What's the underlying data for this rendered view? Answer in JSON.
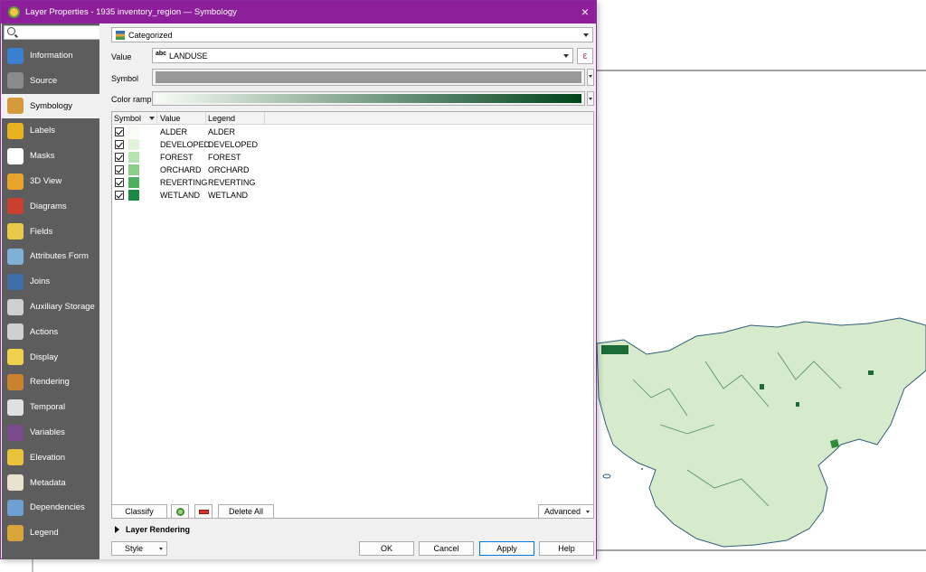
{
  "window": {
    "title": "Layer Properties - 1935 inventory_region — Symbology",
    "close": "×"
  },
  "sidebar": {
    "search_placeholder": "",
    "items": [
      {
        "label": "Information",
        "icon": "information-icon",
        "color": "#3b7fd1"
      },
      {
        "label": "Source",
        "icon": "source-icon",
        "color": "#8a8a8a"
      },
      {
        "label": "Symbology",
        "icon": "symbology-icon",
        "color": "#d49a3c"
      },
      {
        "label": "Labels",
        "icon": "labels-icon",
        "color": "#e6b31e"
      },
      {
        "label": "Masks",
        "icon": "masks-icon",
        "color": "#ffffff"
      },
      {
        "label": "3D View",
        "icon": "3d-view-icon",
        "color": "#e8a32a"
      },
      {
        "label": "Diagrams",
        "icon": "diagrams-icon",
        "color": "#c9402e"
      },
      {
        "label": "Fields",
        "icon": "fields-icon",
        "color": "#e9c94a"
      },
      {
        "label": "Attributes Form",
        "icon": "attributes-form-icon",
        "color": "#7fb0d8"
      },
      {
        "label": "Joins",
        "icon": "joins-icon",
        "color": "#3d6ea8"
      },
      {
        "label": "Auxiliary Storage",
        "icon": "auxiliary-storage-icon",
        "color": "#cfcfcf"
      },
      {
        "label": "Actions",
        "icon": "actions-icon",
        "color": "#d0d0d0"
      },
      {
        "label": "Display",
        "icon": "display-icon",
        "color": "#f0d14e"
      },
      {
        "label": "Rendering",
        "icon": "rendering-icon",
        "color": "#c9812d"
      },
      {
        "label": "Temporal",
        "icon": "temporal-icon",
        "color": "#e0e0e0"
      },
      {
        "label": "Variables",
        "icon": "variables-icon",
        "color": "#7a4a8a"
      },
      {
        "label": "Elevation",
        "icon": "elevation-icon",
        "color": "#e7c23a"
      },
      {
        "label": "Metadata",
        "icon": "metadata-icon",
        "color": "#e8e2cf"
      },
      {
        "label": "Dependencies",
        "icon": "dependencies-icon",
        "color": "#6f9fd0"
      },
      {
        "label": "Legend",
        "icon": "legend-icon",
        "color": "#d9a43a"
      }
    ],
    "selected_index": 2
  },
  "renderer": {
    "selected": "Categorized",
    "icon": "categorized-icon"
  },
  "value_row": {
    "label": "Value",
    "field_type": "abc",
    "field": "LANDUSE",
    "expression_icon": "ε"
  },
  "symbol_row": {
    "label": "Symbol",
    "color": "#999999"
  },
  "ramp_row": {
    "label": "Color ramp",
    "from": "#f7fcf5",
    "to": "#00441b"
  },
  "table": {
    "headers": {
      "symbol": "Symbol",
      "value": "Value",
      "legend": "Legend"
    },
    "rows": [
      {
        "value": "ALDER",
        "legend": "ALDER",
        "color": "#f7fcf5"
      },
      {
        "value": "DEVELOPED",
        "legend": "DEVELOPED",
        "color": "#e0f3db"
      },
      {
        "value": "FOREST",
        "legend": "FOREST",
        "color": "#b7e2b1"
      },
      {
        "value": "ORCHARD",
        "legend": "ORCHARD",
        "color": "#8ccf89"
      },
      {
        "value": "REVERTING",
        "legend": "REVERTING",
        "color": "#4faf61"
      },
      {
        "value": "WETLAND",
        "legend": "WETLAND",
        "color": "#1d8840"
      }
    ]
  },
  "buttons": {
    "classify": "Classify",
    "delete_all": "Delete All",
    "advanced": "Advanced",
    "layer_rendering": "Layer Rendering",
    "style": "Style",
    "ok": "OK",
    "cancel": "Cancel",
    "apply": "Apply",
    "help": "Help"
  },
  "colors": {
    "titlebar": "#8e1f9a",
    "sidebar": "#5d5d5d",
    "map_fill": "#d6ebcc",
    "map_edge": "#2f5c7d"
  }
}
